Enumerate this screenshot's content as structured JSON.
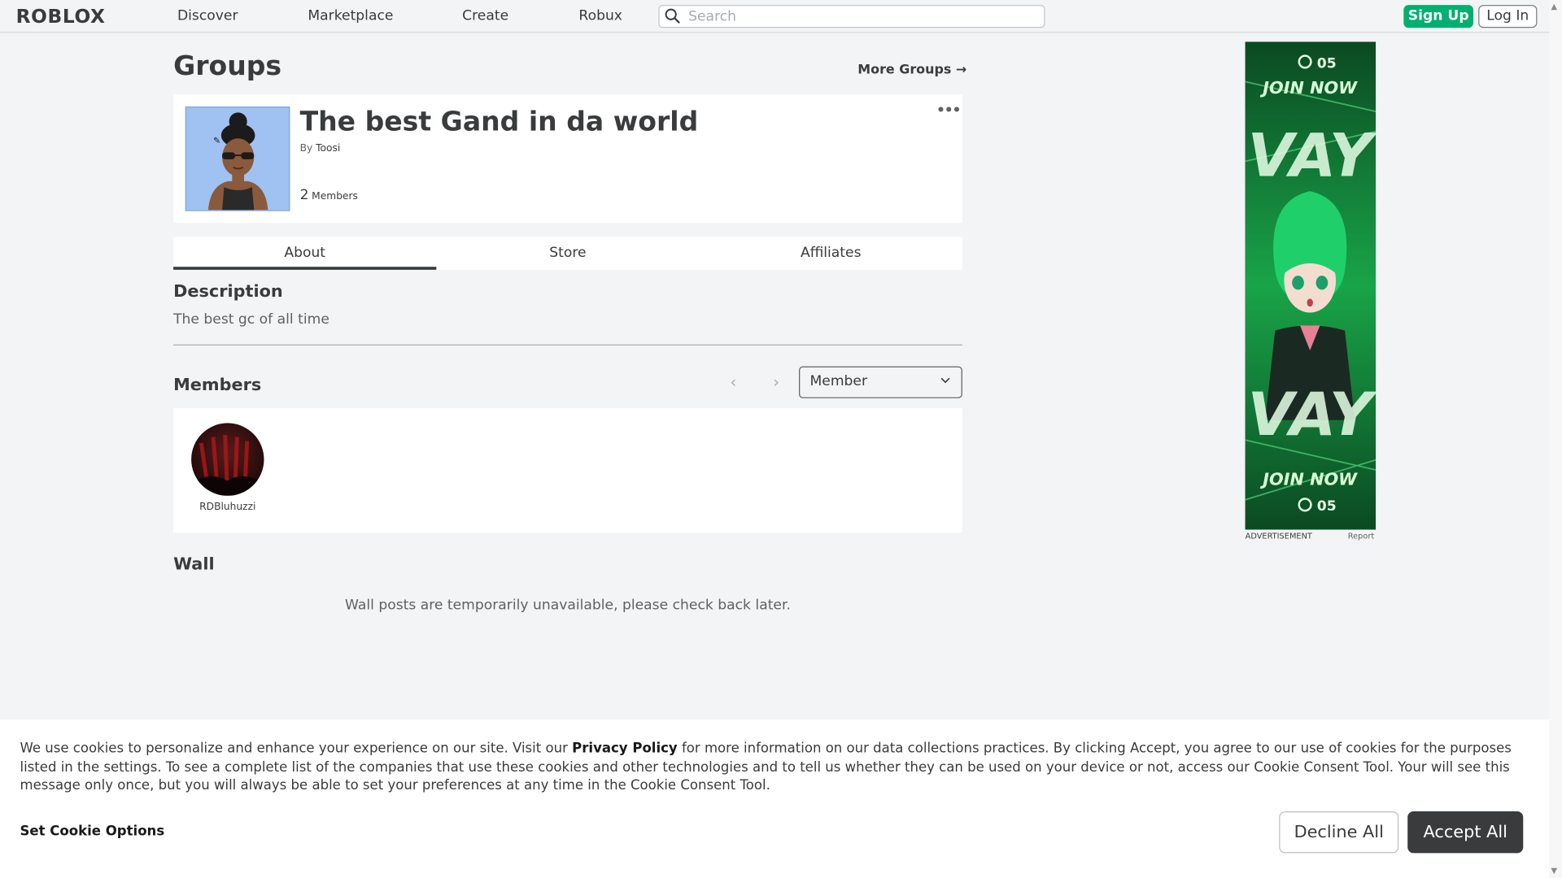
{
  "header": {
    "logo": "ROBLOX",
    "nav": [
      "Discover",
      "Marketplace",
      "Create",
      "Robux"
    ],
    "search_placeholder": "Search",
    "signup_label": "Sign Up",
    "login_label": "Log In"
  },
  "page": {
    "title": "Groups",
    "more_groups_label": "More Groups →"
  },
  "group": {
    "name": "The best Gand in da world",
    "by_prefix": "By",
    "owner": "Toosi",
    "member_count": "2",
    "member_count_label": "Members",
    "more_menu": "•••"
  },
  "tabs": [
    {
      "label": "About",
      "active": true
    },
    {
      "label": "Store",
      "active": false
    },
    {
      "label": "Affiliates",
      "active": false
    }
  ],
  "description": {
    "heading": "Description",
    "text": "The best gc of all time"
  },
  "members": {
    "heading": "Members",
    "role_selected": "Member",
    "list": [
      {
        "username": "RDBluhuzzi"
      }
    ]
  },
  "wall": {
    "heading": "Wall",
    "message": "Wall posts are temporarily unavailable, please check back later."
  },
  "ad": {
    "label": "ADVERTISEMENT",
    "report_label": "Report",
    "top_text": "JOIN NOW",
    "bottom_text": "JOIN NOW",
    "badge": "05",
    "big_letters": "VAY",
    "accent_color": "#18c45c"
  },
  "cookie": {
    "text_part1": "We use cookies to personalize and enhance your experience on our site. Visit our ",
    "privacy_link": "Privacy Policy",
    "text_part2": " for more information on our data collections practices. By clicking Accept, you agree to our use of cookies for the purposes listed in the settings. To see a complete list of the companies that use these cookies and other technologies and to tell us whether they can be used on your device or not, access our Cookie Consent Tool. Your will see this message only once, but you will always be able to set your preferences at any time in the Cookie Consent Tool.",
    "set_options_label": "Set Cookie Options",
    "decline_label": "Decline All",
    "accept_label": "Accept All"
  },
  "colors": {
    "signup_green": "#00b06f",
    "text_dark": "#393b3d",
    "page_bg": "#f2f4f5",
    "emblem_bg": "#9fc2f2"
  }
}
